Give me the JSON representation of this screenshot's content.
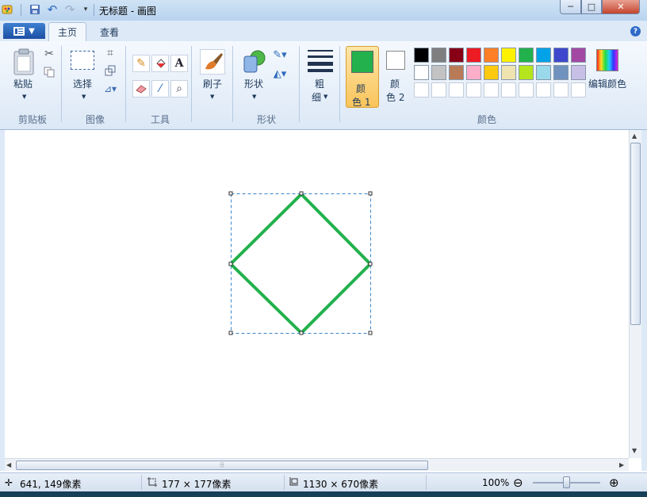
{
  "window": {
    "title": "无标题 - 画图"
  },
  "tabs": {
    "menu_icon": "paint-menu-icon",
    "home": "主页",
    "view": "查看",
    "help": "?"
  },
  "ribbon": {
    "clipboard": {
      "paste": "粘贴",
      "group": "剪贴板"
    },
    "image": {
      "select": "选择",
      "group": "图像"
    },
    "tools": {
      "group": "工具",
      "text_tool": "A"
    },
    "brushes": {
      "label": "刷子"
    },
    "shapes": {
      "label": "形状",
      "group": "形状"
    },
    "size": {
      "line1": "粗",
      "line2": "细"
    },
    "colors": {
      "color1_line1": "颜",
      "color1_line2": "色 1",
      "color2_line1": "颜",
      "color2_line2": "色 2",
      "edit": "编辑颜色",
      "group": "颜色",
      "color1_value": "#22b14c",
      "color2_value": "#ffffff",
      "palette_row1": [
        "#000000",
        "#7f7f7f",
        "#880015",
        "#ed1c24",
        "#ff7f27",
        "#fff200",
        "#22b14c",
        "#00a2e8",
        "#3f48cc",
        "#a349a4"
      ],
      "palette_row2": [
        "#ffffff",
        "#c3c3c3",
        "#b97a57",
        "#ffaec9",
        "#ffc90e",
        "#efe4b0",
        "#b5e61d",
        "#99d9ea",
        "#7092be",
        "#c8bfe7"
      ]
    }
  },
  "canvas": {
    "shape": "diamond",
    "stroke_color": "#22b14c"
  },
  "status": {
    "cursor_pos": "641, 149像素",
    "selection_size": "177 × 177像素",
    "image_size": "1130 × 670像素",
    "zoom": "100%"
  },
  "window_controls": {
    "minimize": "─",
    "maximize": "□",
    "close": "✕"
  }
}
